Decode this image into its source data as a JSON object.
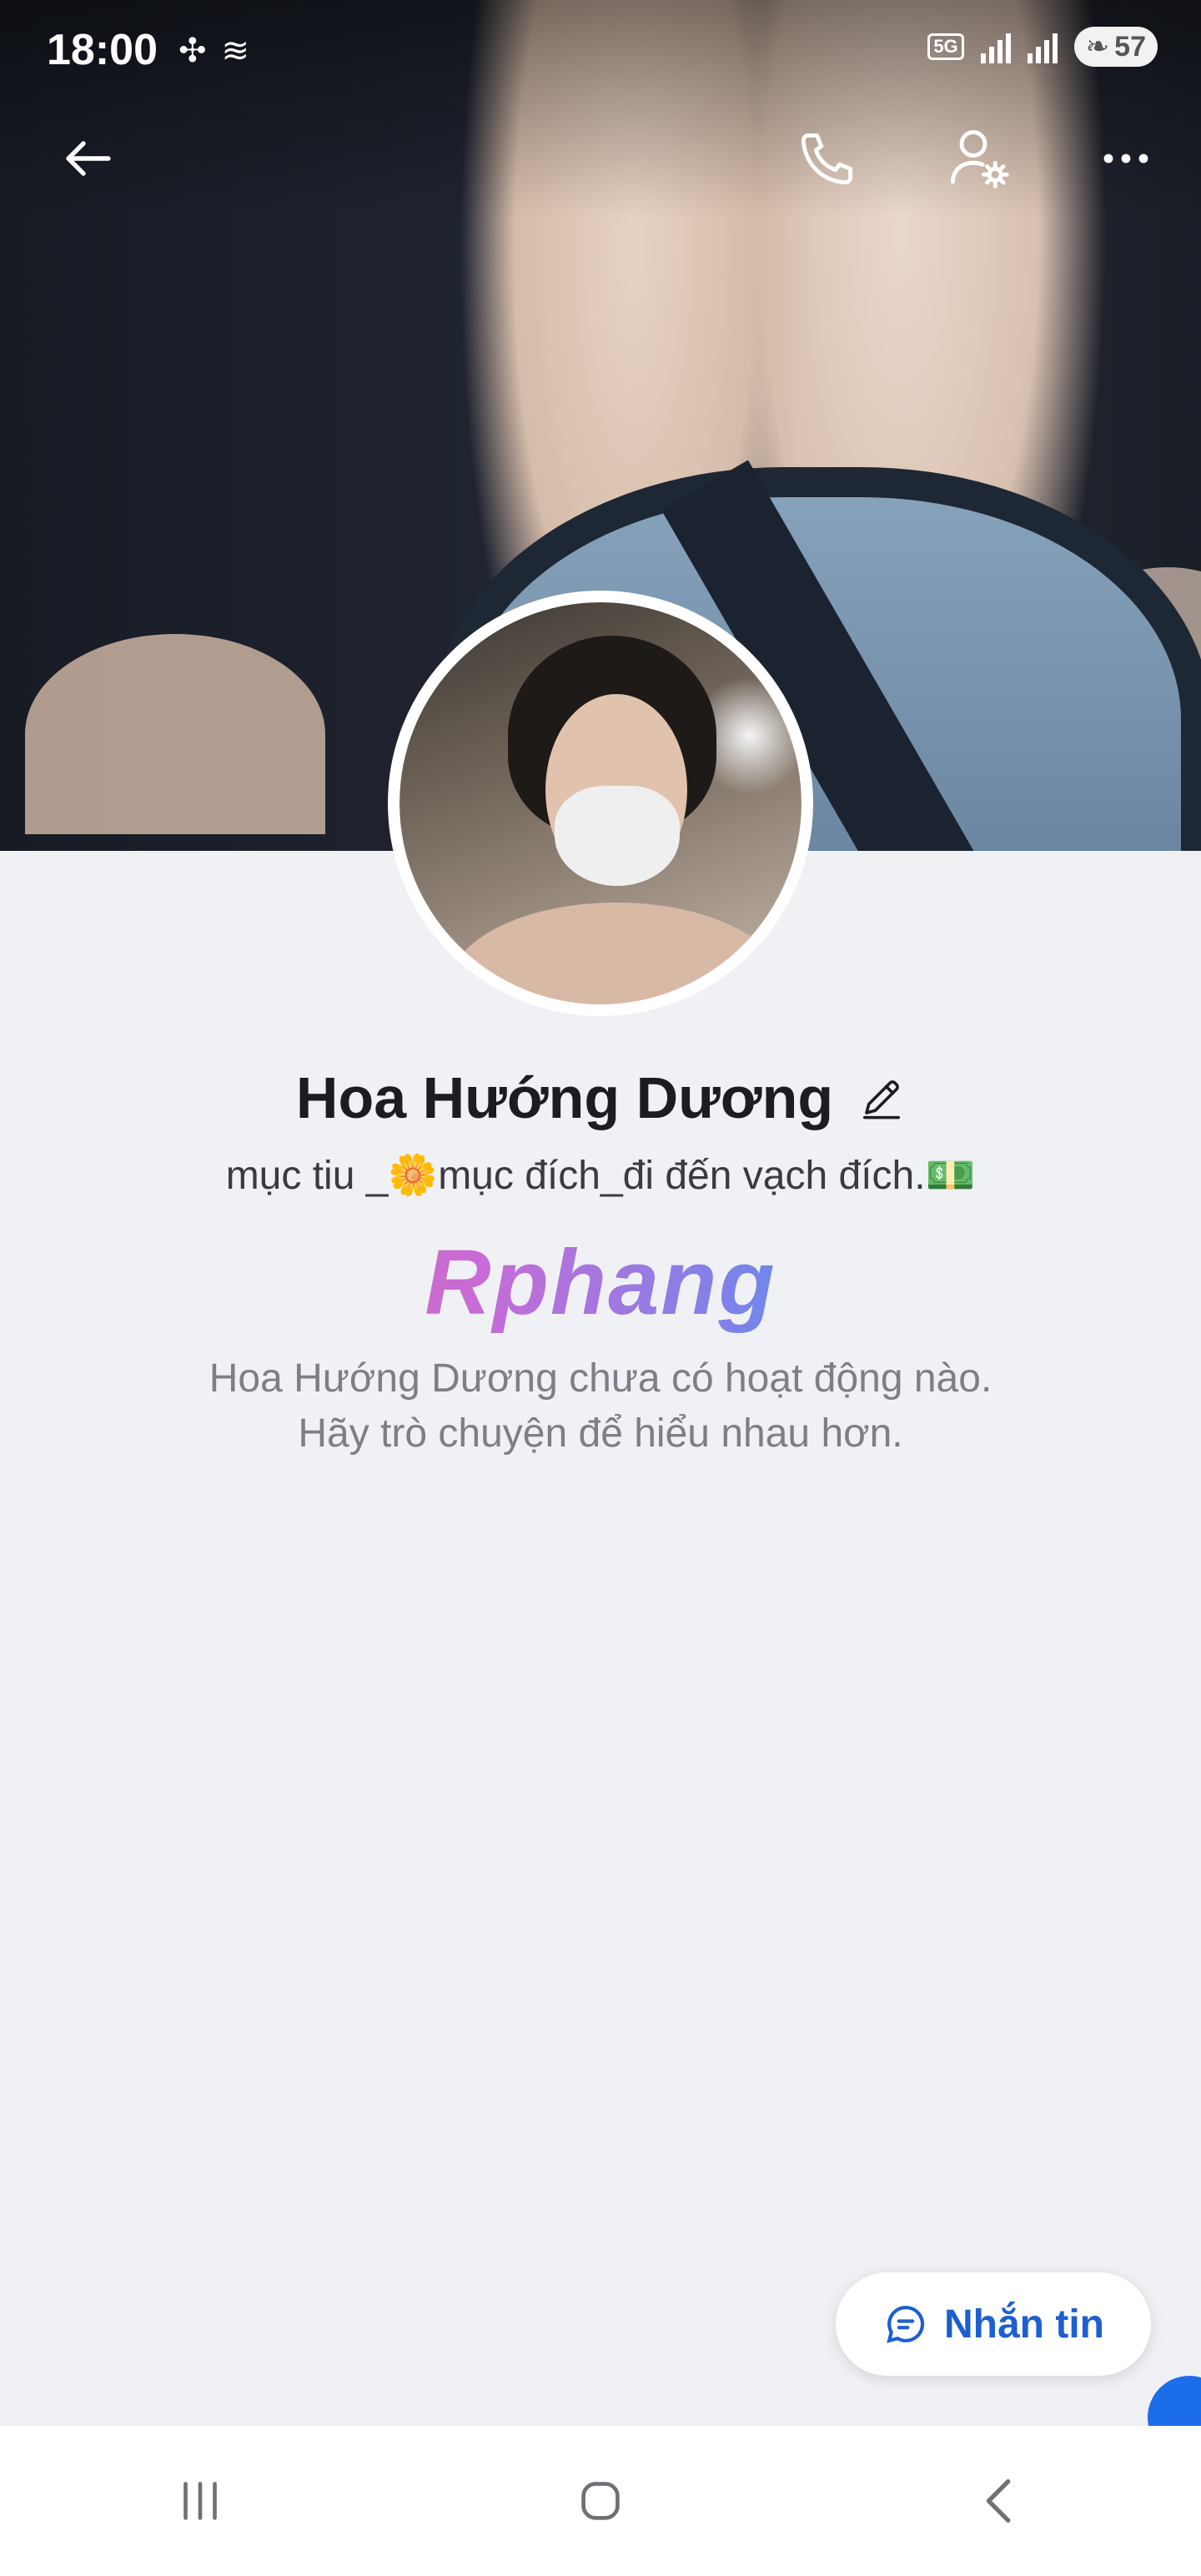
{
  "status_bar": {
    "time": "18:00",
    "network": "5G",
    "battery": "57"
  },
  "toolbar": {
    "back_icon": "arrow-left-icon",
    "call_icon": "phone-icon",
    "settings_icon": "user-settings-icon",
    "more_icon": "more-horizontal-icon"
  },
  "profile": {
    "name": "Hoa Hướng Dương",
    "bio": "mục tiu _🌼mục đích_đi đến vạch đích.💵",
    "watermark": "Rphang",
    "empty_line_1": "Hoa Hướng Dương chưa có hoạt động nào.",
    "empty_line_2": "Hãy trò chuyện để hiểu nhau hơn."
  },
  "actions": {
    "message_label": "Nhắn tin"
  },
  "colors": {
    "accent": "#1d5fd0",
    "background": "#f0f1f5"
  }
}
